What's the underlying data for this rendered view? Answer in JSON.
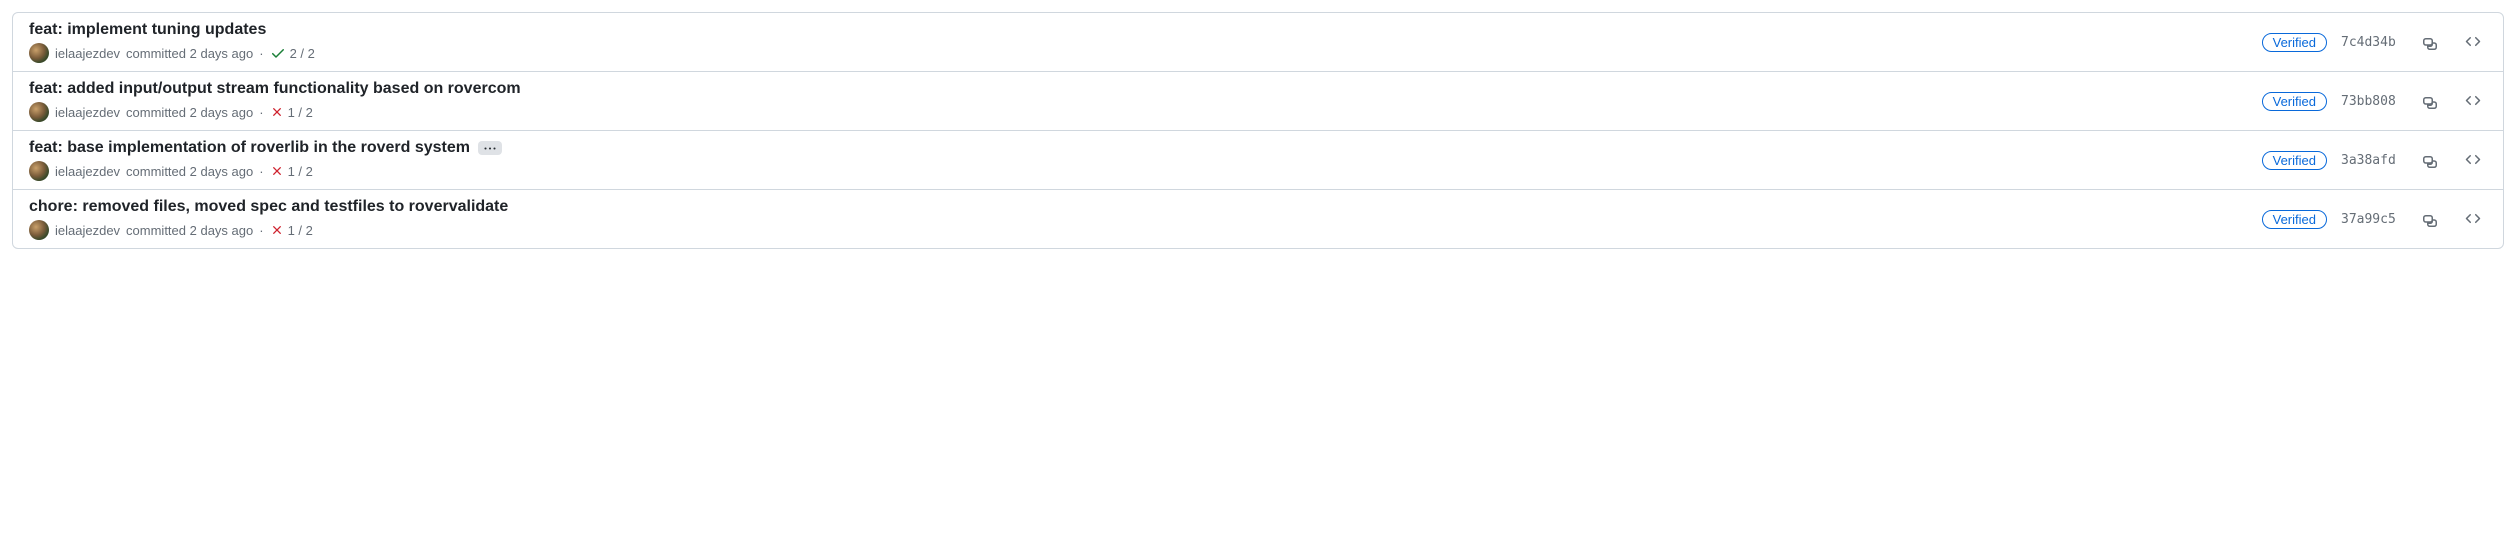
{
  "commits": [
    {
      "title": "feat: implement tuning updates",
      "author": "ielaajezdev",
      "meta": "committed 2 days ago",
      "status": {
        "state": "success",
        "passed": 2,
        "total": 2
      },
      "show_ellipsis": false,
      "verified_label": "Verified",
      "sha": "7c4d34b"
    },
    {
      "title": "feat: added input/output stream functionality based on rovercom",
      "author": "ielaajezdev",
      "meta": "committed 2 days ago",
      "status": {
        "state": "failure",
        "passed": 1,
        "total": 2
      },
      "show_ellipsis": false,
      "verified_label": "Verified",
      "sha": "73bb808"
    },
    {
      "title": "feat: base implementation of roverlib in the roverd system",
      "author": "ielaajezdev",
      "meta": "committed 2 days ago",
      "status": {
        "state": "failure",
        "passed": 1,
        "total": 2
      },
      "show_ellipsis": true,
      "verified_label": "Verified",
      "sha": "3a38afd"
    },
    {
      "title": "chore: removed files, moved spec and testfiles to rovervalidate",
      "author": "ielaajezdev",
      "meta": "committed 2 days ago",
      "status": {
        "state": "failure",
        "passed": 1,
        "total": 2
      },
      "show_ellipsis": false,
      "verified_label": "Verified",
      "sha": "37a99c5"
    }
  ]
}
